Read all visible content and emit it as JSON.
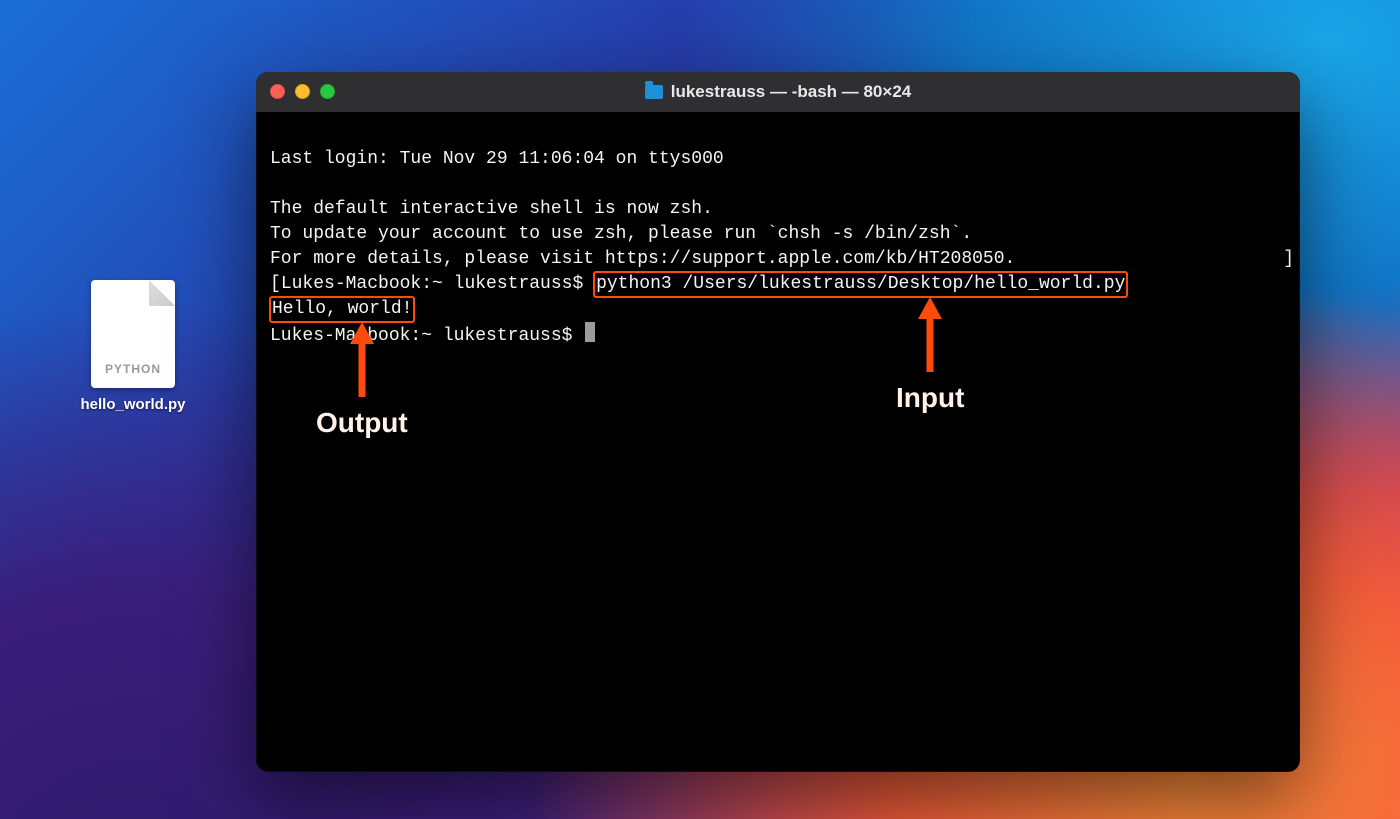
{
  "desktop": {
    "file": {
      "badge": "PYTHON",
      "filename": "hello_world.py"
    }
  },
  "terminal": {
    "window_title": "lukestrauss — -bash — 80×24",
    "lines": {
      "last_login": "Last login: Tue Nov 29 11:06:04 on ttys000",
      "blank": "",
      "zsh1": "The default interactive shell is now zsh.",
      "zsh2": "To update your account to use zsh, please run `chsh -s /bin/zsh`.",
      "zsh3": "For more details, please visit https://support.apple.com/kb/HT208050.",
      "prompt_open": "[",
      "prompt1": "Lukes-Macbook:~ lukestrauss$ ",
      "command": "python3 /Users/lukestrauss/Desktop/hello_world.py",
      "prompt_close_bracket": "]",
      "output": "Hello, world!",
      "prompt2": "Lukes-Macbook:~ lukestrauss$ "
    }
  },
  "annotations": {
    "output_label": "Output",
    "input_label": "Input",
    "highlight_color": "#ff4a0d"
  }
}
